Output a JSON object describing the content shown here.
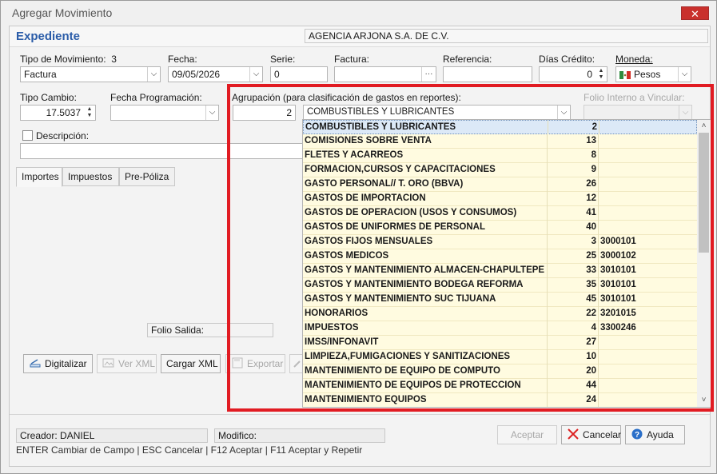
{
  "window": {
    "title": "Agregar Movimiento",
    "close_glyph": "✕"
  },
  "header": {
    "section": "Expediente",
    "entity": "AGENCIA ARJONA S.A. DE C.V."
  },
  "form": {
    "tipo_movimiento_label": "Tipo de Movimiento:",
    "tipo_movimiento_code": "3",
    "tipo_movimiento_value": "Factura",
    "fecha_label": "Fecha:",
    "fecha_value": "09/05/2026",
    "serie_label": "Serie:",
    "serie_value": "0",
    "factura_label": "Factura:",
    "factura_value": "",
    "factura_btn": "···",
    "referencia_label": "Referencia:",
    "referencia_value": "",
    "dias_credito_label": "Días Crédito:",
    "dias_credito_value": "0",
    "moneda_label": "Moneda:",
    "moneda_value": "Pesos",
    "tipo_cambio_label": "Tipo Cambio:",
    "tipo_cambio_value": "17.5037",
    "fecha_programacion_label": "Fecha Programación:",
    "fecha_programacion_value": "",
    "agrupacion_label": "Agrupación (para clasificación de gastos en reportes):",
    "agrupacion_code": "2",
    "agrupacion_value": "COMBUSTIBLES Y LUBRICANTES",
    "folio_interno_label": "Folio Interno a Vincular:",
    "descripcion_label": "Descripción:"
  },
  "tabs": [
    {
      "label": "Importes"
    },
    {
      "label": "Impuestos"
    },
    {
      "label": "Pre-Póliza"
    }
  ],
  "panel": {
    "folio_salida_label": "Folio Salida:",
    "digitalizar": "Digitalizar",
    "ver_xml": "Ver XML",
    "cargar_xml": "Cargar XML",
    "exportar": "Exportar"
  },
  "dropdown_rows": [
    {
      "name": "COMBUSTIBLES Y LUBRICANTES",
      "code": "2",
      "account": ""
    },
    {
      "name": "COMISIONES SOBRE VENTA",
      "code": "13",
      "account": ""
    },
    {
      "name": "FLETES Y ACARREOS",
      "code": "8",
      "account": ""
    },
    {
      "name": "FORMACION,CURSOS Y CAPACITACIONES",
      "code": "9",
      "account": ""
    },
    {
      "name": "GASTO PERSONAL// T. ORO (BBVA)",
      "code": "26",
      "account": ""
    },
    {
      "name": "GASTOS DE IMPORTACION",
      "code": "12",
      "account": ""
    },
    {
      "name": "GASTOS DE OPERACION (USOS Y CONSUMOS)",
      "code": "41",
      "account": ""
    },
    {
      "name": "GASTOS DE UNIFORMES DE PERSONAL",
      "code": "40",
      "account": ""
    },
    {
      "name": "GASTOS FIJOS  MENSUALES",
      "code": "3",
      "account": "3000101"
    },
    {
      "name": "GASTOS MEDICOS",
      "code": "25",
      "account": "3000102"
    },
    {
      "name": "GASTOS Y MANTENIMIENTO ALMACEN-CHAPULTEPEC",
      "code": "33",
      "account": "3010101"
    },
    {
      "name": "GASTOS Y MANTENIMIENTO BODEGA REFORMA",
      "code": "35",
      "account": "3010101"
    },
    {
      "name": "GASTOS Y MANTENIMIENTO SUC TIJUANA",
      "code": "45",
      "account": "3010101"
    },
    {
      "name": "HONORARIOS",
      "code": "22",
      "account": "3201015"
    },
    {
      "name": "IMPUESTOS",
      "code": "4",
      "account": "3300246"
    },
    {
      "name": "IMSS/INFONAVIT",
      "code": "27",
      "account": ""
    },
    {
      "name": "LIMPIEZA,FUMIGACIONES Y SANITIZACIONES",
      "code": "10",
      "account": ""
    },
    {
      "name": "MANTENIMIENTO DE EQUIPO DE COMPUTO",
      "code": "20",
      "account": ""
    },
    {
      "name": "MANTENIMIENTO DE EQUIPOS DE PROTECCION",
      "code": "44",
      "account": ""
    },
    {
      "name": "MANTENIMIENTO EQUIPOS",
      "code": "24",
      "account": ""
    }
  ],
  "footer": {
    "creador_label": "Creador:",
    "creador_value": "DANIEL",
    "modifico_label": "Modifico:",
    "modifico_value": "",
    "aceptar": "Aceptar",
    "cancelar": "Cancelar",
    "ayuda": "Ayuda",
    "hint": "ENTER Cambiar de Campo | ESC Cancelar | F12 Aceptar | F11 Aceptar y Repetir"
  },
  "colors": {
    "highlight_frame": "#e11b22",
    "section_title": "#2a5ca8",
    "row_bg": "#fffbe0"
  }
}
